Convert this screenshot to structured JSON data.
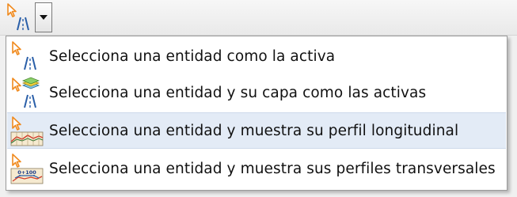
{
  "toolbar": {
    "split_button": {
      "icon": "select-entity-road-icon",
      "dropdown_icon": "chevron-down-icon"
    }
  },
  "menu": {
    "items": [
      {
        "label": "Selecciona una entidad como la activa",
        "icon": "select-entity-road-icon"
      },
      {
        "label": "Selecciona una entidad y su capa como las activas",
        "icon": "select-entity-layer-icon"
      },
      {
        "label": "Selecciona una entidad y muestra su perfil longitudinal",
        "icon": "longitudinal-profile-icon",
        "highlighted": true
      },
      {
        "label": "Selecciona una entidad y muestra sus perfiles transversales",
        "icon": "cross-section-icon",
        "icon_text": "0+100"
      }
    ]
  },
  "colors": {
    "highlight": "#e3ebf6",
    "cursor_orange": "#f08a1e",
    "road_blue": "#2a5fa8",
    "profile_red": "#d23c2a"
  }
}
